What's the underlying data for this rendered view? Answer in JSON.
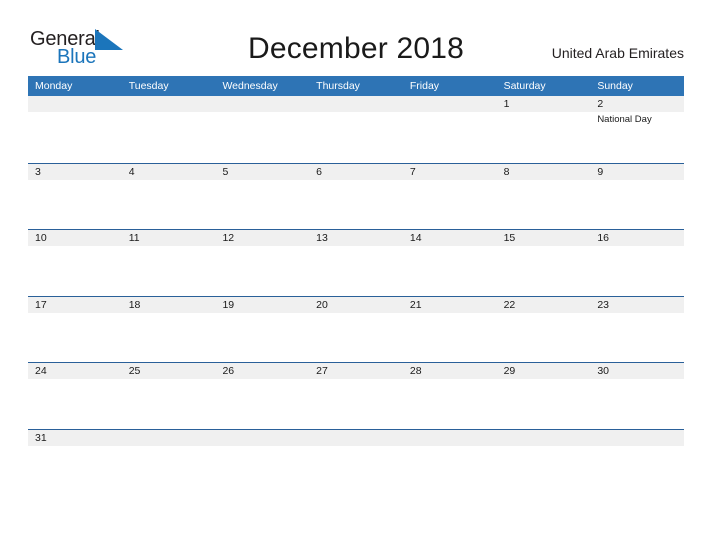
{
  "brand": {
    "name_part1": "General",
    "name_part2": "Blue",
    "flag_color": "#1b75bb",
    "text_color": "#231f20"
  },
  "header": {
    "title": "December 2018",
    "country": "United Arab Emirates"
  },
  "colors": {
    "header_blue": "#2e74b5",
    "rule_blue": "#2a6099",
    "band_gray": "#f0f0f0",
    "text": "#1a1a1a"
  },
  "calendar": {
    "month": "December",
    "year": "2018",
    "weekday_headers": [
      "Monday",
      "Tuesday",
      "Wednesday",
      "Thursday",
      "Friday",
      "Saturday",
      "Sunday"
    ],
    "weeks": [
      {
        "days": [
          {
            "date": "",
            "events": []
          },
          {
            "date": "",
            "events": []
          },
          {
            "date": "",
            "events": []
          },
          {
            "date": "",
            "events": []
          },
          {
            "date": "",
            "events": []
          },
          {
            "date": "1",
            "events": []
          },
          {
            "date": "2",
            "events": [
              "National Day"
            ]
          }
        ]
      },
      {
        "days": [
          {
            "date": "3",
            "events": []
          },
          {
            "date": "4",
            "events": []
          },
          {
            "date": "5",
            "events": []
          },
          {
            "date": "6",
            "events": []
          },
          {
            "date": "7",
            "events": []
          },
          {
            "date": "8",
            "events": []
          },
          {
            "date": "9",
            "events": []
          }
        ]
      },
      {
        "days": [
          {
            "date": "10",
            "events": []
          },
          {
            "date": "11",
            "events": []
          },
          {
            "date": "12",
            "events": []
          },
          {
            "date": "13",
            "events": []
          },
          {
            "date": "14",
            "events": []
          },
          {
            "date": "15",
            "events": []
          },
          {
            "date": "16",
            "events": []
          }
        ]
      },
      {
        "days": [
          {
            "date": "17",
            "events": []
          },
          {
            "date": "18",
            "events": []
          },
          {
            "date": "19",
            "events": []
          },
          {
            "date": "20",
            "events": []
          },
          {
            "date": "21",
            "events": []
          },
          {
            "date": "22",
            "events": []
          },
          {
            "date": "23",
            "events": []
          }
        ]
      },
      {
        "days": [
          {
            "date": "24",
            "events": []
          },
          {
            "date": "25",
            "events": []
          },
          {
            "date": "26",
            "events": []
          },
          {
            "date": "27",
            "events": []
          },
          {
            "date": "28",
            "events": []
          },
          {
            "date": "29",
            "events": []
          },
          {
            "date": "30",
            "events": []
          }
        ]
      },
      {
        "days": [
          {
            "date": "31",
            "events": []
          },
          {
            "date": "",
            "events": []
          },
          {
            "date": "",
            "events": []
          },
          {
            "date": "",
            "events": []
          },
          {
            "date": "",
            "events": []
          },
          {
            "date": "",
            "events": []
          },
          {
            "date": "",
            "events": []
          }
        ]
      }
    ]
  }
}
